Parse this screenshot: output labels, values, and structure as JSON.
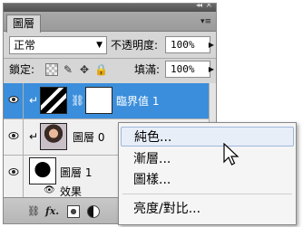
{
  "panel": {
    "title_tab": "圖層",
    "menu_icon": "panel-menu-icon",
    "top_controls": {
      "collapse": "◂◂",
      "close": "×"
    }
  },
  "options": {
    "blend_mode": "正常",
    "opacity_label": "不透明度:",
    "opacity_value": "100%",
    "lock_label": "鎖定:",
    "fill_label": "填滿:",
    "fill_value": "100%"
  },
  "layers": [
    {
      "name": "臨界值 1",
      "selected": true
    },
    {
      "name": "圖層 0",
      "selected": false
    },
    {
      "name": "圖層 1",
      "selected": false
    }
  ],
  "effects_label": "效果",
  "context_menu": {
    "items": [
      "純色...",
      "漸層...",
      "圖樣...",
      "亮度/對比..."
    ]
  },
  "colors": {
    "selection": "#3b8edb",
    "panel_bg": "#d6d6d6",
    "layers_bg": "#f0f0f0"
  }
}
